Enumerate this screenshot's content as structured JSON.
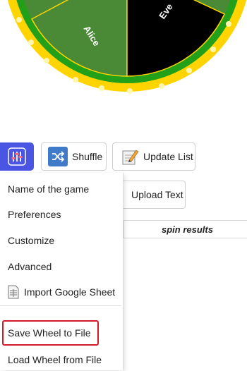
{
  "wheel": {
    "segments": [
      {
        "label": "Alice",
        "color": "#4a8a37"
      },
      {
        "label": "Eve",
        "color": "#000000"
      }
    ],
    "rim_color": "#ffd400",
    "ring_color": "#22a019"
  },
  "toolbar": {
    "settings_icon": "sliders-icon",
    "shuffle_label": "Shuffle",
    "shuffle_icon": "shuffle-icon",
    "update_label": "Update List",
    "update_icon": "notepad-pencil-icon",
    "upload_label": "Upload Text",
    "upload_icon": "document-icon",
    "accent_color": "#4a55e3"
  },
  "results": {
    "header": "spin results"
  },
  "menu": {
    "items": [
      {
        "label": "Name of the game"
      },
      {
        "label": "Preferences"
      },
      {
        "label": "Customize"
      },
      {
        "label": "Advanced"
      },
      {
        "label": "Import Google Sheet",
        "icon": "spreadsheet-icon"
      },
      {
        "label": "Save Wheel to File",
        "highlighted": true
      },
      {
        "label": "Load Wheel from File"
      }
    ],
    "highlight_color": "#d11a2a"
  }
}
